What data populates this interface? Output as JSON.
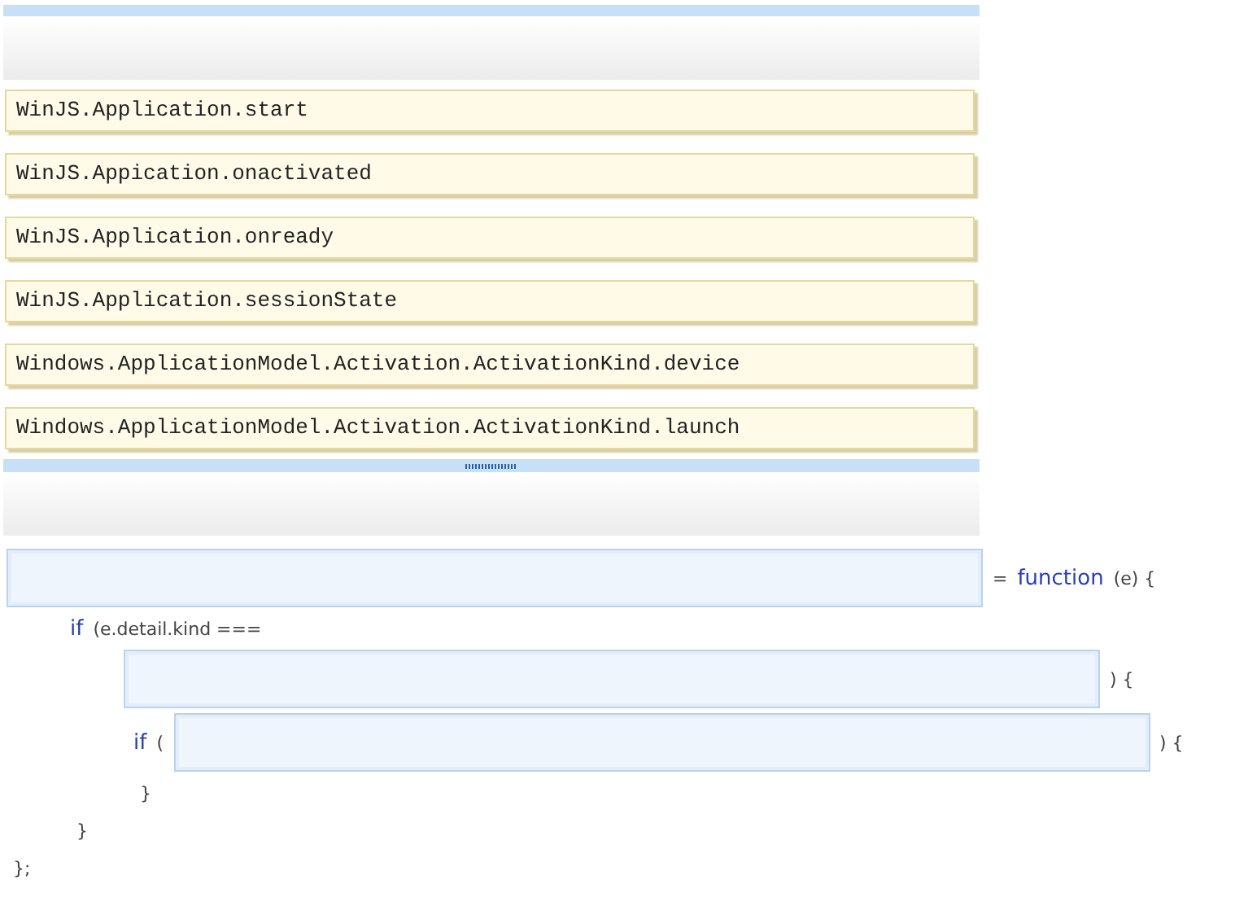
{
  "choices": [
    {
      "label": "WinJS.Application.start"
    },
    {
      "label": "WinJS.Appication.onactivated"
    },
    {
      "label": "WinJS.Application.onready"
    },
    {
      "label": "WinJS.Application.sessionState"
    },
    {
      "label": "Windows.ApplicationModel.Activation.ActivationKind.device"
    },
    {
      "label": "Windows.ApplicationModel.Activation.ActivationKind.launch"
    }
  ],
  "code": {
    "rows": [
      [
        {
          "kind": "slot"
        },
        {
          "kind": "text",
          "text": "="
        },
        {
          "kind": "keyword",
          "text": "function"
        },
        {
          "kind": "text",
          "text": "(e) {"
        }
      ]
    ],
    "children": [
      {
        "rows": [
          [
            {
              "kind": "keyword",
              "text": "if"
            },
            {
              "kind": "text",
              "text": "(e.detail.kind ==="
            }
          ],
          [
            {
              "kind": "slot"
            },
            {
              "kind": "text",
              "text": ") {"
            }
          ]
        ],
        "children": [
          {
            "rows": [
              [
                {
                  "kind": "keyword",
                  "text": "if"
                },
                {
                  "kind": "text",
                  "text": "("
                },
                {
                  "kind": "slot"
                },
                {
                  "kind": "text",
                  "text": ") {"
                }
              ]
            ],
            "close": "}"
          }
        ],
        "close": "}"
      }
    ],
    "close": "};"
  }
}
